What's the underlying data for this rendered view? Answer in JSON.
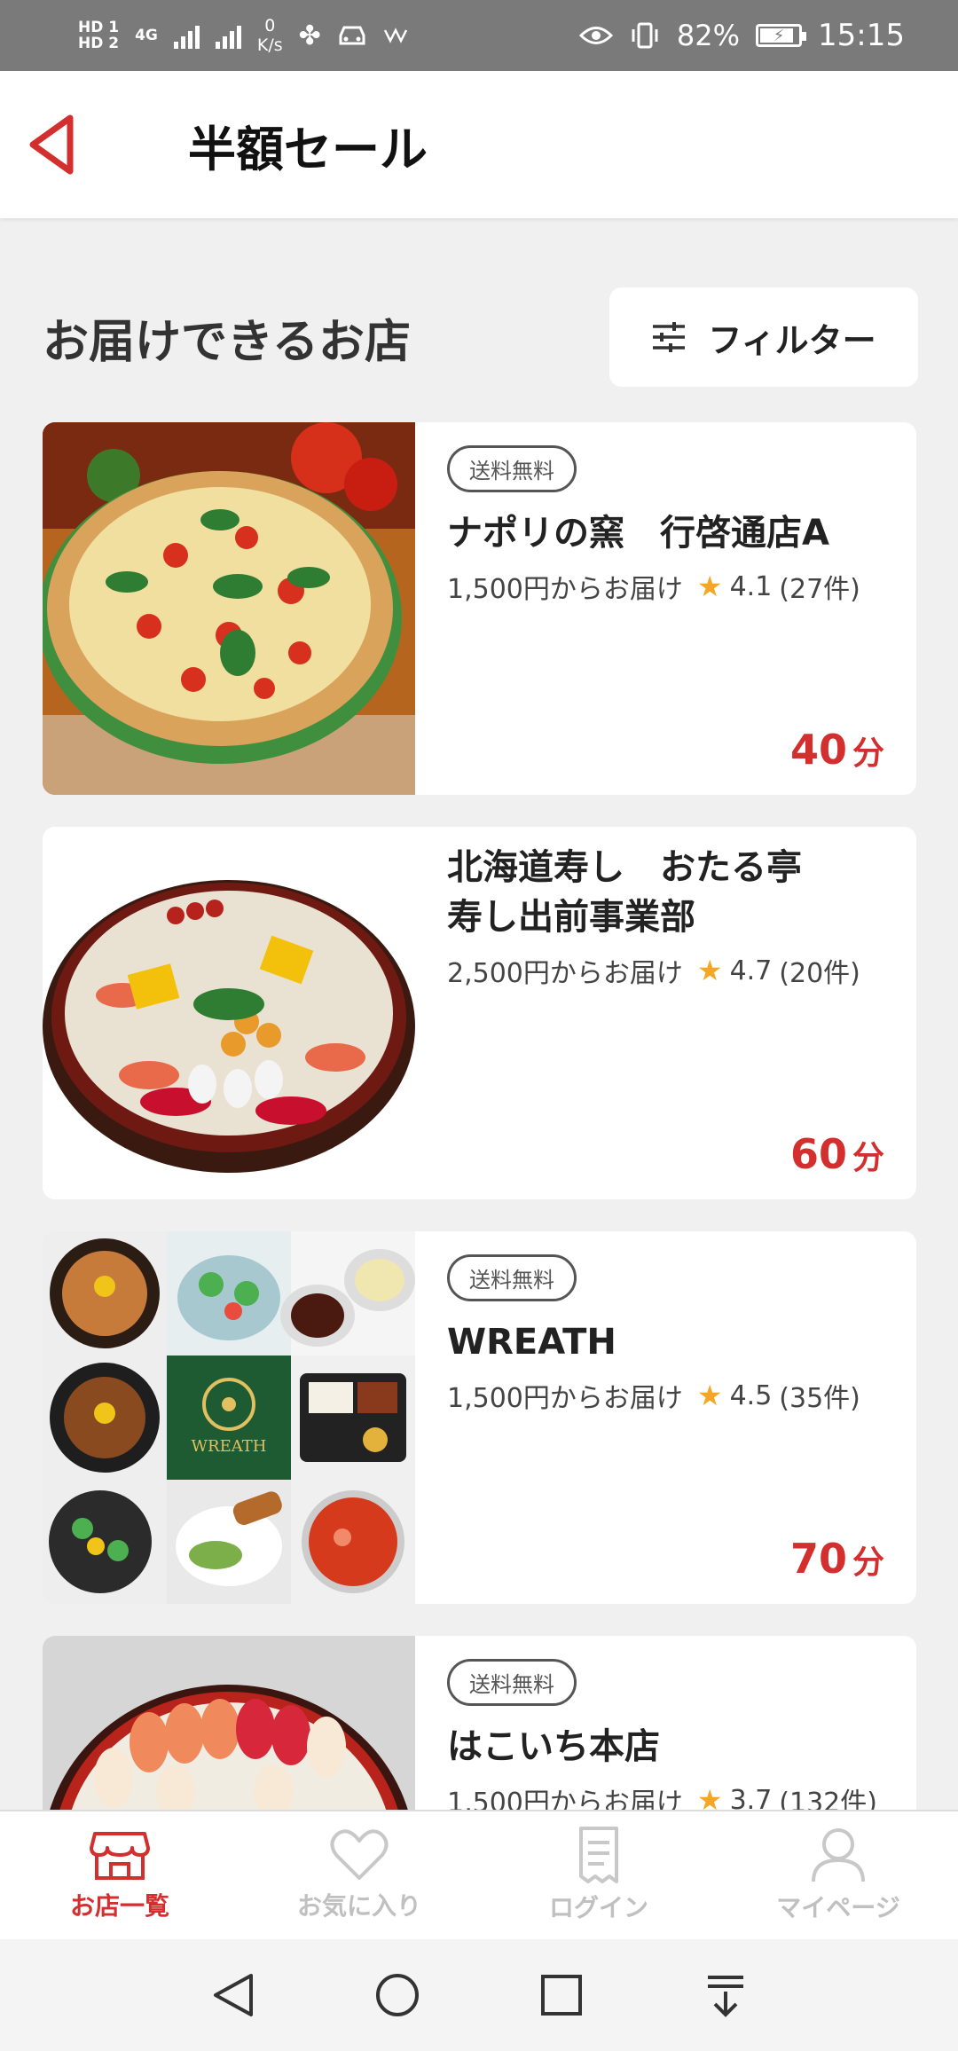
{
  "status_bar": {
    "sim1": "HD 1",
    "sim2": "HD 2",
    "network": "4G",
    "speed_value": "0",
    "speed_unit": "K/s",
    "battery": "82%",
    "time": "15:15"
  },
  "header": {
    "title": "半額セール"
  },
  "section": {
    "title": "お届けできるお店",
    "filter_label": "フィルター"
  },
  "stores": [
    {
      "badge": "送料無料",
      "name": "ナポリの窯　行啓通店A",
      "min_order": "1,500円からお届け",
      "rating": "4.1",
      "reviews": "(27件)",
      "time": "40",
      "time_unit": "分"
    },
    {
      "badge": "",
      "name": "北海道寿し　おたる亭 寿し出前事業部",
      "min_order": "2,500円からお届け",
      "rating": "4.7",
      "reviews": "(20件)",
      "time": "60",
      "time_unit": "分"
    },
    {
      "badge": "送料無料",
      "name": "WREATH",
      "min_order": "1,500円からお届け",
      "rating": "4.5",
      "reviews": "(35件)",
      "time": "70",
      "time_unit": "分"
    },
    {
      "badge": "送料無料",
      "name": "はこいち本店",
      "min_order": "1,500円からお届け",
      "rating": "3.7",
      "reviews": "(132件)",
      "time": "",
      "time_unit": ""
    }
  ],
  "wreath_logo_text": "WREATH",
  "tabs": [
    {
      "label": "お店一覧",
      "icon": "shop-icon",
      "active": true
    },
    {
      "label": "お気に入り",
      "icon": "heart-icon",
      "active": false
    },
    {
      "label": "ログイン",
      "icon": "document-icon",
      "active": false
    },
    {
      "label": "マイページ",
      "icon": "person-icon",
      "active": false
    }
  ],
  "colors": {
    "accent": "#d32f2f",
    "star": "#f5a623",
    "status_bar": "#7a7a7a"
  }
}
